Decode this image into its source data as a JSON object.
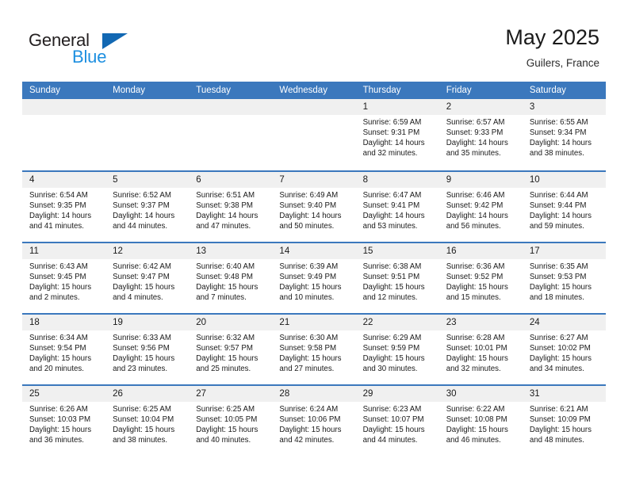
{
  "logo": {
    "word_top": "General",
    "word_bottom": "Blue",
    "triangle_icon": "triangle-icon",
    "colors": {
      "dark": "#231f20",
      "blue": "#1d8fe0",
      "triangle": "#1268b3"
    }
  },
  "header": {
    "title": "May 2025",
    "subtitle": "Guilers, France"
  },
  "colors": {
    "header_row_bg": "#3b78bd",
    "day_band_bg": "#f0f0f0",
    "row_divider": "#3b78bd",
    "text": "#1a1a1a"
  },
  "weekdays": [
    "Sunday",
    "Monday",
    "Tuesday",
    "Wednesday",
    "Thursday",
    "Friday",
    "Saturday"
  ],
  "labels": {
    "sunrise_prefix": "Sunrise:",
    "sunset_prefix": "Sunset:",
    "daylight_prefix": "Daylight:"
  },
  "weeks": [
    [
      {
        "day": "",
        "empty": true,
        "sunrise": "",
        "sunset": "",
        "daylight_line1": "",
        "daylight_line2": ""
      },
      {
        "day": "",
        "empty": true,
        "sunrise": "",
        "sunset": "",
        "daylight_line1": "",
        "daylight_line2": ""
      },
      {
        "day": "",
        "empty": true,
        "sunrise": "",
        "sunset": "",
        "daylight_line1": "",
        "daylight_line2": ""
      },
      {
        "day": "",
        "empty": true,
        "sunrise": "",
        "sunset": "",
        "daylight_line1": "",
        "daylight_line2": ""
      },
      {
        "day": "1",
        "empty": false,
        "sunrise": "Sunrise: 6:59 AM",
        "sunset": "Sunset: 9:31 PM",
        "daylight_line1": "Daylight: 14 hours",
        "daylight_line2": "and 32 minutes."
      },
      {
        "day": "2",
        "empty": false,
        "sunrise": "Sunrise: 6:57 AM",
        "sunset": "Sunset: 9:33 PM",
        "daylight_line1": "Daylight: 14 hours",
        "daylight_line2": "and 35 minutes."
      },
      {
        "day": "3",
        "empty": false,
        "sunrise": "Sunrise: 6:55 AM",
        "sunset": "Sunset: 9:34 PM",
        "daylight_line1": "Daylight: 14 hours",
        "daylight_line2": "and 38 minutes."
      }
    ],
    [
      {
        "day": "4",
        "empty": false,
        "sunrise": "Sunrise: 6:54 AM",
        "sunset": "Sunset: 9:35 PM",
        "daylight_line1": "Daylight: 14 hours",
        "daylight_line2": "and 41 minutes."
      },
      {
        "day": "5",
        "empty": false,
        "sunrise": "Sunrise: 6:52 AM",
        "sunset": "Sunset: 9:37 PM",
        "daylight_line1": "Daylight: 14 hours",
        "daylight_line2": "and 44 minutes."
      },
      {
        "day": "6",
        "empty": false,
        "sunrise": "Sunrise: 6:51 AM",
        "sunset": "Sunset: 9:38 PM",
        "daylight_line1": "Daylight: 14 hours",
        "daylight_line2": "and 47 minutes."
      },
      {
        "day": "7",
        "empty": false,
        "sunrise": "Sunrise: 6:49 AM",
        "sunset": "Sunset: 9:40 PM",
        "daylight_line1": "Daylight: 14 hours",
        "daylight_line2": "and 50 minutes."
      },
      {
        "day": "8",
        "empty": false,
        "sunrise": "Sunrise: 6:47 AM",
        "sunset": "Sunset: 9:41 PM",
        "daylight_line1": "Daylight: 14 hours",
        "daylight_line2": "and 53 minutes."
      },
      {
        "day": "9",
        "empty": false,
        "sunrise": "Sunrise: 6:46 AM",
        "sunset": "Sunset: 9:42 PM",
        "daylight_line1": "Daylight: 14 hours",
        "daylight_line2": "and 56 minutes."
      },
      {
        "day": "10",
        "empty": false,
        "sunrise": "Sunrise: 6:44 AM",
        "sunset": "Sunset: 9:44 PM",
        "daylight_line1": "Daylight: 14 hours",
        "daylight_line2": "and 59 minutes."
      }
    ],
    [
      {
        "day": "11",
        "empty": false,
        "sunrise": "Sunrise: 6:43 AM",
        "sunset": "Sunset: 9:45 PM",
        "daylight_line1": "Daylight: 15 hours",
        "daylight_line2": "and 2 minutes."
      },
      {
        "day": "12",
        "empty": false,
        "sunrise": "Sunrise: 6:42 AM",
        "sunset": "Sunset: 9:47 PM",
        "daylight_line1": "Daylight: 15 hours",
        "daylight_line2": "and 4 minutes."
      },
      {
        "day": "13",
        "empty": false,
        "sunrise": "Sunrise: 6:40 AM",
        "sunset": "Sunset: 9:48 PM",
        "daylight_line1": "Daylight: 15 hours",
        "daylight_line2": "and 7 minutes."
      },
      {
        "day": "14",
        "empty": false,
        "sunrise": "Sunrise: 6:39 AM",
        "sunset": "Sunset: 9:49 PM",
        "daylight_line1": "Daylight: 15 hours",
        "daylight_line2": "and 10 minutes."
      },
      {
        "day": "15",
        "empty": false,
        "sunrise": "Sunrise: 6:38 AM",
        "sunset": "Sunset: 9:51 PM",
        "daylight_line1": "Daylight: 15 hours",
        "daylight_line2": "and 12 minutes."
      },
      {
        "day": "16",
        "empty": false,
        "sunrise": "Sunrise: 6:36 AM",
        "sunset": "Sunset: 9:52 PM",
        "daylight_line1": "Daylight: 15 hours",
        "daylight_line2": "and 15 minutes."
      },
      {
        "day": "17",
        "empty": false,
        "sunrise": "Sunrise: 6:35 AM",
        "sunset": "Sunset: 9:53 PM",
        "daylight_line1": "Daylight: 15 hours",
        "daylight_line2": "and 18 minutes."
      }
    ],
    [
      {
        "day": "18",
        "empty": false,
        "sunrise": "Sunrise: 6:34 AM",
        "sunset": "Sunset: 9:54 PM",
        "daylight_line1": "Daylight: 15 hours",
        "daylight_line2": "and 20 minutes."
      },
      {
        "day": "19",
        "empty": false,
        "sunrise": "Sunrise: 6:33 AM",
        "sunset": "Sunset: 9:56 PM",
        "daylight_line1": "Daylight: 15 hours",
        "daylight_line2": "and 23 minutes."
      },
      {
        "day": "20",
        "empty": false,
        "sunrise": "Sunrise: 6:32 AM",
        "sunset": "Sunset: 9:57 PM",
        "daylight_line1": "Daylight: 15 hours",
        "daylight_line2": "and 25 minutes."
      },
      {
        "day": "21",
        "empty": false,
        "sunrise": "Sunrise: 6:30 AM",
        "sunset": "Sunset: 9:58 PM",
        "daylight_line1": "Daylight: 15 hours",
        "daylight_line2": "and 27 minutes."
      },
      {
        "day": "22",
        "empty": false,
        "sunrise": "Sunrise: 6:29 AM",
        "sunset": "Sunset: 9:59 PM",
        "daylight_line1": "Daylight: 15 hours",
        "daylight_line2": "and 30 minutes."
      },
      {
        "day": "23",
        "empty": false,
        "sunrise": "Sunrise: 6:28 AM",
        "sunset": "Sunset: 10:01 PM",
        "daylight_line1": "Daylight: 15 hours",
        "daylight_line2": "and 32 minutes."
      },
      {
        "day": "24",
        "empty": false,
        "sunrise": "Sunrise: 6:27 AM",
        "sunset": "Sunset: 10:02 PM",
        "daylight_line1": "Daylight: 15 hours",
        "daylight_line2": "and 34 minutes."
      }
    ],
    [
      {
        "day": "25",
        "empty": false,
        "sunrise": "Sunrise: 6:26 AM",
        "sunset": "Sunset: 10:03 PM",
        "daylight_line1": "Daylight: 15 hours",
        "daylight_line2": "and 36 minutes."
      },
      {
        "day": "26",
        "empty": false,
        "sunrise": "Sunrise: 6:25 AM",
        "sunset": "Sunset: 10:04 PM",
        "daylight_line1": "Daylight: 15 hours",
        "daylight_line2": "and 38 minutes."
      },
      {
        "day": "27",
        "empty": false,
        "sunrise": "Sunrise: 6:25 AM",
        "sunset": "Sunset: 10:05 PM",
        "daylight_line1": "Daylight: 15 hours",
        "daylight_line2": "and 40 minutes."
      },
      {
        "day": "28",
        "empty": false,
        "sunrise": "Sunrise: 6:24 AM",
        "sunset": "Sunset: 10:06 PM",
        "daylight_line1": "Daylight: 15 hours",
        "daylight_line2": "and 42 minutes."
      },
      {
        "day": "29",
        "empty": false,
        "sunrise": "Sunrise: 6:23 AM",
        "sunset": "Sunset: 10:07 PM",
        "daylight_line1": "Daylight: 15 hours",
        "daylight_line2": "and 44 minutes."
      },
      {
        "day": "30",
        "empty": false,
        "sunrise": "Sunrise: 6:22 AM",
        "sunset": "Sunset: 10:08 PM",
        "daylight_line1": "Daylight: 15 hours",
        "daylight_line2": "and 46 minutes."
      },
      {
        "day": "31",
        "empty": false,
        "sunrise": "Sunrise: 6:21 AM",
        "sunset": "Sunset: 10:09 PM",
        "daylight_line1": "Daylight: 15 hours",
        "daylight_line2": "and 48 minutes."
      }
    ]
  ]
}
